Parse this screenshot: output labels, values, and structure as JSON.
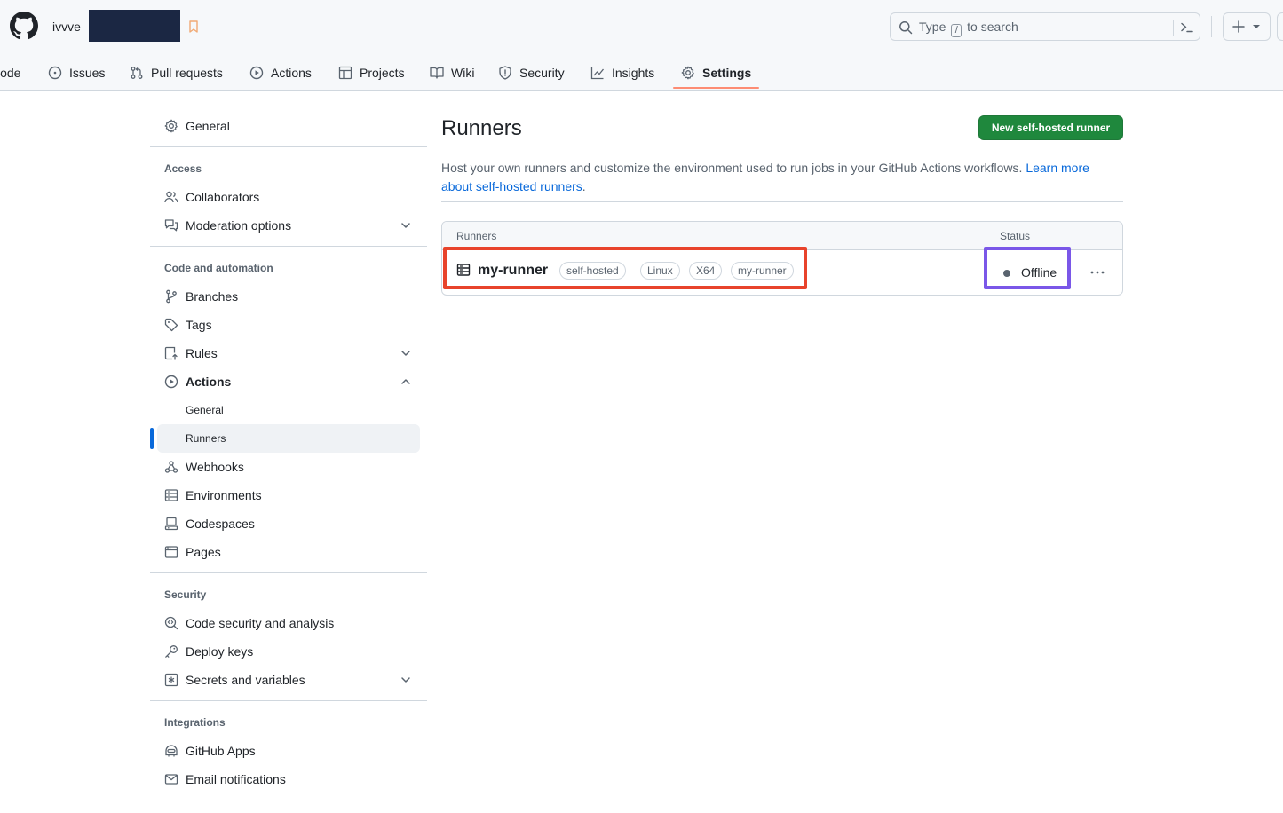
{
  "header": {
    "owner": "ivvve",
    "search_text_before": "Type",
    "search_key": "/",
    "search_text_after": "to search"
  },
  "tabs": [
    {
      "label": "Code",
      "icon": "code-icon"
    },
    {
      "label": "Issues",
      "icon": "issue-icon"
    },
    {
      "label": "Pull requests",
      "icon": "pull-request-icon"
    },
    {
      "label": "Actions",
      "icon": "play-icon"
    },
    {
      "label": "Projects",
      "icon": "table-icon"
    },
    {
      "label": "Wiki",
      "icon": "book-icon"
    },
    {
      "label": "Security",
      "icon": "shield-icon"
    },
    {
      "label": "Insights",
      "icon": "graph-icon"
    },
    {
      "label": "Settings",
      "icon": "gear-icon",
      "active": true
    }
  ],
  "sidebar": {
    "general": "General",
    "access_heading": "Access",
    "collaborators": "Collaborators",
    "moderation": "Moderation options",
    "code_heading": "Code and automation",
    "branches": "Branches",
    "tags": "Tags",
    "rules": "Rules",
    "actions": "Actions",
    "actions_general": "General",
    "actions_runners": "Runners",
    "webhooks": "Webhooks",
    "environments": "Environments",
    "codespaces": "Codespaces",
    "pages": "Pages",
    "security_heading": "Security",
    "code_security": "Code security and analysis",
    "deploy_keys": "Deploy keys",
    "secrets": "Secrets and variables",
    "integrations_heading": "Integrations",
    "github_apps": "GitHub Apps",
    "email_notifications": "Email notifications"
  },
  "main": {
    "title": "Runners",
    "new_button": "New self-hosted runner",
    "description": "Host your own runners and customize the environment used to run jobs in your GitHub Actions workflows.",
    "learn_more": "Learn more about self-hosted runners",
    "description_end": ".",
    "col_runners": "Runners",
    "col_status": "Status",
    "runner": {
      "name": "my-runner",
      "labels": [
        "self-hosted",
        "Linux",
        "X64",
        "my-runner"
      ],
      "status": "Offline"
    }
  },
  "colors": {
    "accent": "#0969da",
    "primary_button": "#1f883d",
    "tab_underline": "#fd8c73",
    "highlight_red": "#e8432b",
    "highlight_purple": "#7a57e8"
  }
}
